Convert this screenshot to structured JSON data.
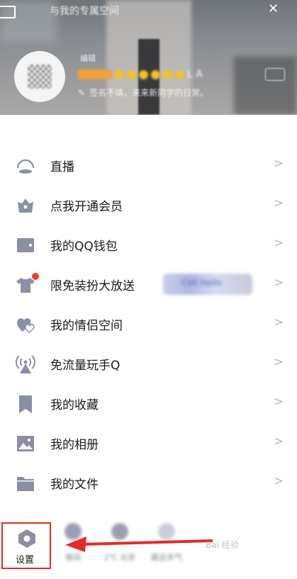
{
  "header": {
    "title": "与我的专属空间",
    "close_glyph": "✕",
    "tag": "编辑",
    "nickname_suffix": "L A",
    "signature": "签名不填，来来新同学的日常。"
  },
  "menu": [
    {
      "label": "直播",
      "icon": "live-icon",
      "badge": false
    },
    {
      "label": "点我开通会员",
      "icon": "vip-icon",
      "badge": false
    },
    {
      "label": "我的QQ钱包",
      "icon": "wallet-icon",
      "badge": false
    },
    {
      "label": "限免装扮大放送",
      "icon": "theme-shirt-icon",
      "badge": true,
      "promo": "Coll.Hello"
    },
    {
      "label": "我的情侣空间",
      "icon": "couple-hearts-icon",
      "badge": false
    },
    {
      "label": "免流量玩手Q",
      "icon": "signal-tower-icon",
      "badge": false
    },
    {
      "label": "我的收藏",
      "icon": "bookmark-icon",
      "badge": false
    },
    {
      "label": "我的相册",
      "icon": "photo-icon",
      "badge": false
    },
    {
      "label": "我的文件",
      "icon": "folder-icon",
      "badge": false
    }
  ],
  "chevron": ">",
  "bottom": {
    "settings_label": "设置",
    "items": [
      {
        "label": "夜间",
        "icon": "night-mode-icon"
      },
      {
        "label": "2℃ 北京",
        "icon": "weather-icon"
      },
      {
        "label": "最近天气",
        "icon": "weather-icon"
      }
    ]
  },
  "watermark": "Bai 经验",
  "colors": {
    "accent_red": "#e22b2b",
    "icon_gray": "#8a8fa6",
    "badge_red": "#f3402a"
  }
}
